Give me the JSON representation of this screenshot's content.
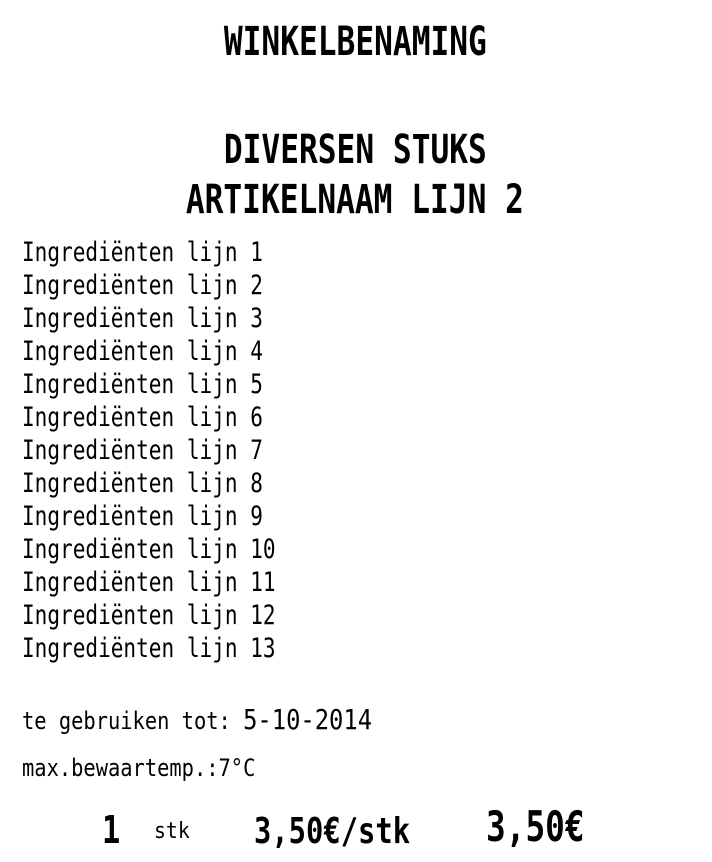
{
  "store_name": "WINKELBENAMING",
  "article": {
    "line1": "DIVERSEN STUKS",
    "line2": "ARTIKELNAAM LIJN 2"
  },
  "ingredients": [
    "Ingrediënten lijn 1",
    "Ingrediënten lijn 2",
    "Ingrediënten lijn 3",
    "Ingrediënten lijn 4",
    "Ingrediënten lijn 5",
    "Ingrediënten lijn 6",
    "Ingrediënten lijn 7",
    "Ingrediënten lijn 8",
    "Ingrediënten lijn 9",
    "Ingrediënten lijn 10",
    "Ingrediënten lijn 11",
    "Ingrediënten lijn 12",
    "Ingrediënten lijn 13"
  ],
  "use_by": {
    "label": "te gebruiken tot:",
    "date": "5-10-2014"
  },
  "storage": "max.bewaartemp.:7°C",
  "price": {
    "quantity": "1",
    "unit": "stk",
    "unit_price": "3,50€/stk",
    "total": "3,50€"
  }
}
